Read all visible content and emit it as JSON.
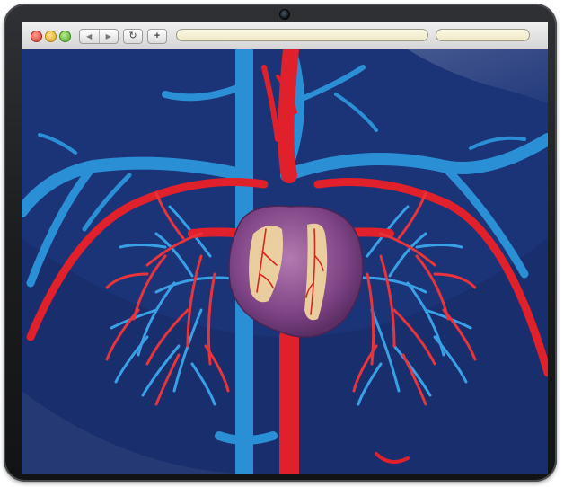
{
  "browser": {
    "url_value": "",
    "search_value": "",
    "back_icon": "arrow-left-icon",
    "forward_icon": "arrow-right-icon",
    "reload_icon": "reload-icon",
    "new_tab_icon": "plus-icon"
  },
  "content": {
    "image": "heart-circulatory-system-illustration"
  },
  "colors": {
    "background": "#1b3377",
    "artery": "#e0202a",
    "vein": "#2b8fd6",
    "heart": "#8c4e8e"
  }
}
